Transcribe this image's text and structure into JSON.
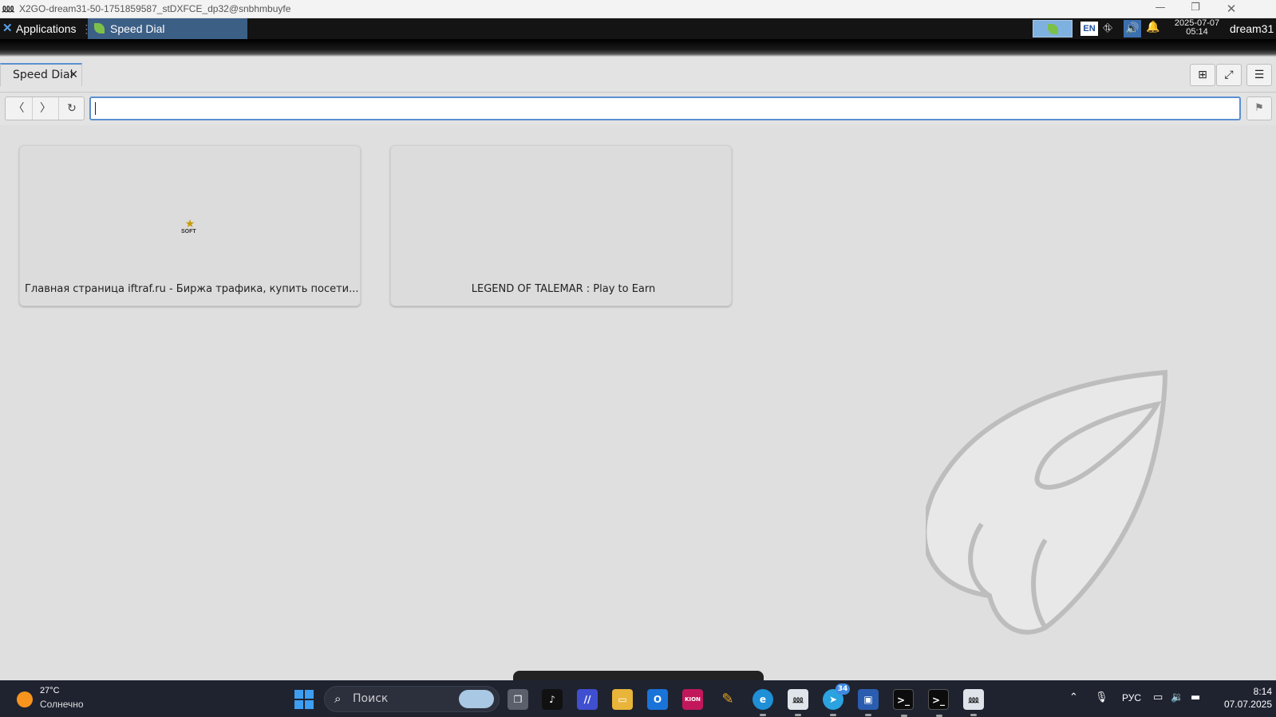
{
  "window": {
    "title": "X2GO-dream31-50-1751859587_stDXFCE_dp32@snbhmbuyfe",
    "minimize_icon": "minimize-icon",
    "maximize_icon": "restore-icon",
    "close_icon": "close-icon"
  },
  "xfce_panel": {
    "applications_label": "Applications",
    "applications_separator": "⋮",
    "task_label": "Speed Dial",
    "keyboard_layout": "EN",
    "clock_date": "2025-07-07",
    "clock_time": "05:14",
    "user": "dream31"
  },
  "browser": {
    "tab_label": "Speed Dial",
    "tab_close": "✕",
    "url_value": "",
    "url_placeholder": "",
    "toolbar_icons": [
      "new-window-icon",
      "fullscreen-icon",
      "menu-icon"
    ],
    "nav_icons": [
      "back-icon",
      "forward-icon",
      "reload-icon"
    ],
    "bookmark_icon": "bookmark-add-icon"
  },
  "speed_dial": {
    "items": [
      {
        "caption": "Главная страница iftraf.ru - Биржа трафика, купить посети...",
        "thumb_text": "SOFT",
        "icon": "star-icon"
      },
      {
        "caption": "LEGEND OF TALEMAR : Play to Earn",
        "thumb_text": "",
        "icon": ""
      }
    ],
    "watermark": "leaf-logo"
  },
  "windows_taskbar": {
    "temperature": "27°C",
    "condition": "Солнечно",
    "search_label": "Поиск",
    "apps": [
      "task-view-icon",
      "tiktok-icon",
      "app-icon",
      "file-explorer-icon",
      "outlook-icon",
      "kion-icon",
      "pin-app-icon",
      "edge-icon",
      "x2go-icon",
      "telegram-icon",
      "remote-desktop-icon",
      "terminal-icon",
      "terminal-icon",
      "x2go-icon"
    ],
    "telegram_badge": "34",
    "kion_label": "KION",
    "language": "РУС",
    "time": "8:14",
    "date": "07.07.2025"
  },
  "colors": {
    "accent": "#5b8fd0",
    "panel_bg": "#141414",
    "content_bg": "#dfdfdf",
    "taskbar_bg": "#1f2330"
  }
}
